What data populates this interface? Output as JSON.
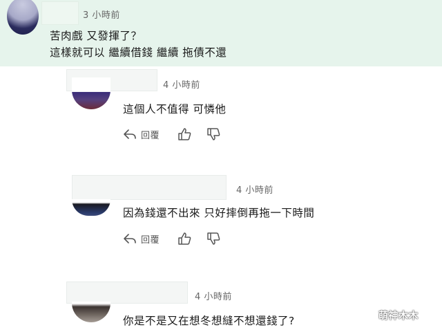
{
  "top_comment": {
    "time": "3 小時前",
    "line1": "苦肉戲 又發揮了？",
    "line2": "這樣就可以 繼續借錢 繼續 拖債不還"
  },
  "replies": [
    {
      "time": "4 小時前",
      "text": "這個人不值得 可憐他",
      "reply_label": "回覆"
    },
    {
      "time": "4 小時前",
      "text": "因為錢還不出來 只好摔倒再拖一下時間",
      "reply_label": "回覆"
    },
    {
      "time": "4 小時前",
      "text": "你是不是又在想冬想縫不想還錢了?"
    }
  ],
  "watermark": "萌神木木",
  "colors": {
    "top_bg": "#e6f4ec",
    "icon": "#555555"
  }
}
